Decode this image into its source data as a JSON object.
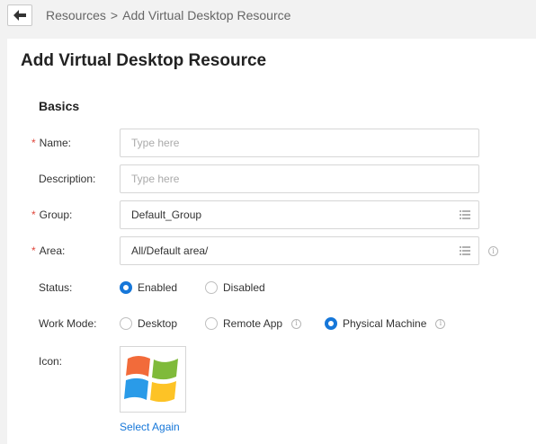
{
  "header": {
    "breadcrumb_root": "Resources",
    "breadcrumb_sep": ">",
    "breadcrumb_current": "Add Virtual Desktop Resource"
  },
  "page": {
    "title": "Add Virtual Desktop Resource",
    "section": "Basics"
  },
  "form": {
    "name": {
      "label": "Name:",
      "placeholder": "Type here",
      "required": true
    },
    "description": {
      "label": "Description:",
      "placeholder": "Type here",
      "required": false
    },
    "group": {
      "label": "Group:",
      "value": "Default_Group",
      "required": true
    },
    "area": {
      "label": "Area:",
      "value": "All/Default area/",
      "required": true
    },
    "status": {
      "label": "Status:",
      "options": [
        "Enabled",
        "Disabled"
      ],
      "selected": "Enabled"
    },
    "work_mode": {
      "label": "Work Mode:",
      "options": [
        "Desktop",
        "Remote App",
        "Physical Machine"
      ],
      "selected": "Physical Machine"
    },
    "icon": {
      "label": "Icon:",
      "image": "windows-logo",
      "action": "Select Again"
    }
  },
  "icons": {
    "back": "back-arrow-icon",
    "list": "list-icon",
    "info": "info-icon"
  },
  "colors": {
    "accent": "#1677d9",
    "required": "#e0463b",
    "background": "#f2f2f2"
  }
}
